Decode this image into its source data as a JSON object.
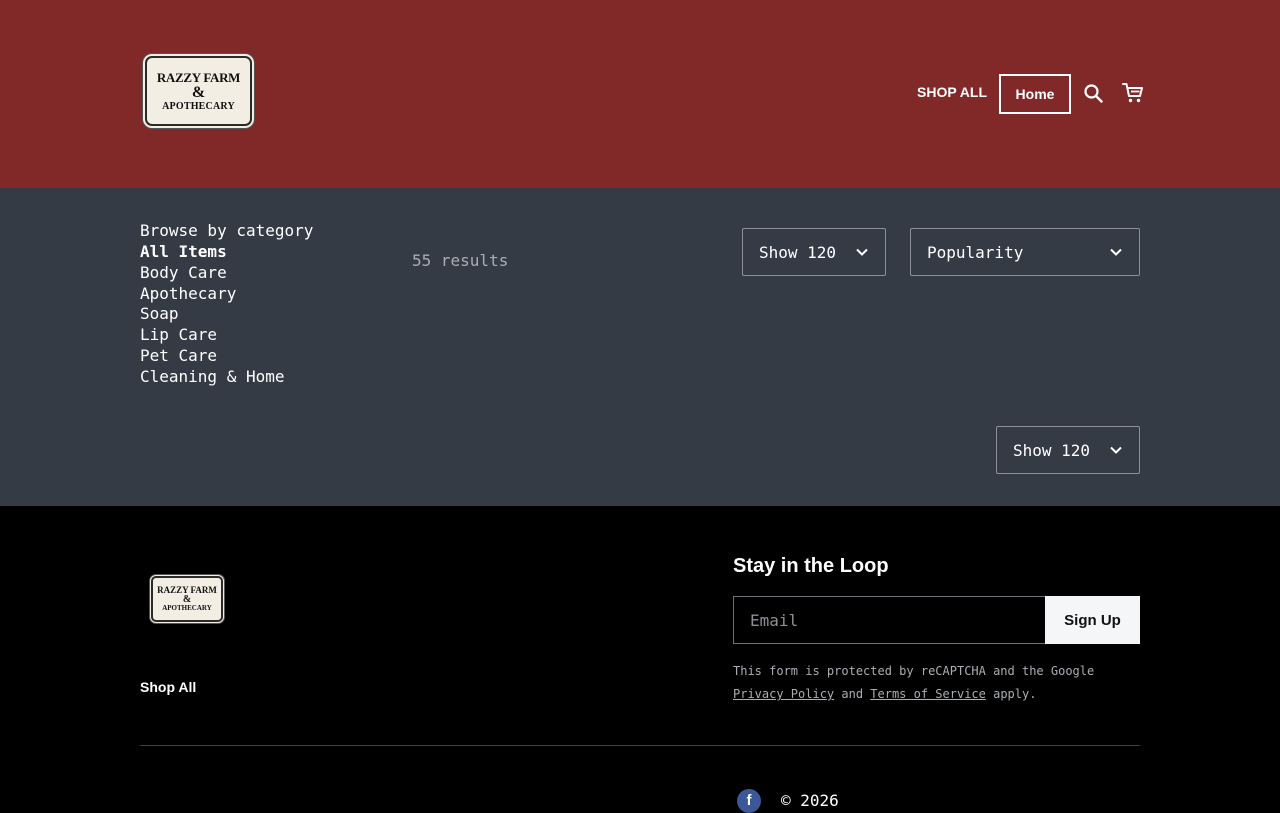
{
  "header": {
    "logo": {
      "line1": "RAZZY FARM",
      "line2": "&",
      "line3": "APOTHECARY"
    },
    "nav_shop_all": "SHOP ALL",
    "nav_home": "Home",
    "search_icon": "search-icon",
    "cart_icon": "cart-icon",
    "bg_color": "#812929"
  },
  "categories": {
    "title": "Browse by category",
    "items": [
      {
        "label": "All Items",
        "active": true
      },
      {
        "label": "Body Care"
      },
      {
        "label": "Apothecary"
      },
      {
        "label": "Soap"
      },
      {
        "label": "Lip Care"
      },
      {
        "label": "Pet Care"
      },
      {
        "label": "Cleaning & Home"
      }
    ]
  },
  "results": {
    "count_text": "55 results"
  },
  "controls": {
    "show_top": "Show 120",
    "sort": "Popularity",
    "show_bottom": "Show 120"
  },
  "footer": {
    "logo": {
      "line1": "RAZZY FARM",
      "line2": "&",
      "line3": "APOTHECARY"
    },
    "shop_all": "Shop All",
    "loop_title": "Stay in the Loop",
    "email_placeholder": "Email",
    "signup_label": "Sign Up",
    "recaptcha_prefix": "This form is protected by reCAPTCHA and the Google ",
    "privacy_link": "Privacy Policy",
    "and_text": " and ",
    "terms_link": "Terms of Service",
    "apply_text": " apply.",
    "facebook_icon": "facebook-icon",
    "copyright": "© 2026"
  }
}
